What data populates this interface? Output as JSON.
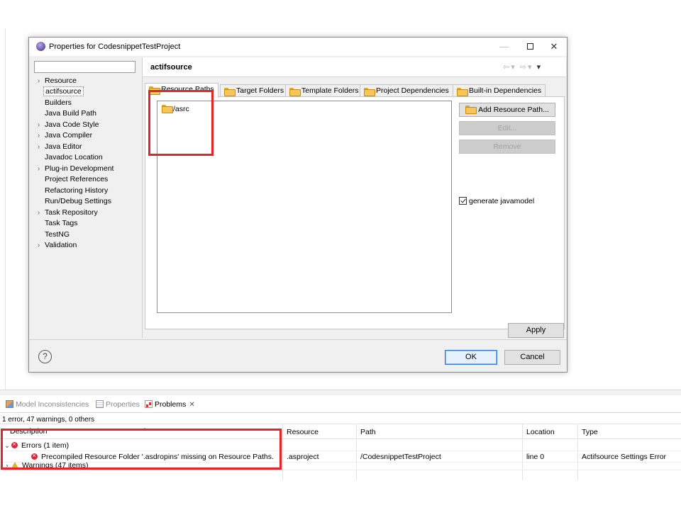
{
  "dialog": {
    "title": "Properties for CodesnippetTestProject",
    "filter": {
      "value": "",
      "placeholder": ""
    },
    "tree": [
      {
        "label": "Resource",
        "expandable": true
      },
      {
        "label": "actifsource",
        "expandable": false,
        "selected": true
      },
      {
        "label": "Builders",
        "expandable": false
      },
      {
        "label": "Java Build Path",
        "expandable": false
      },
      {
        "label": "Java Code Style",
        "expandable": true
      },
      {
        "label": "Java Compiler",
        "expandable": true
      },
      {
        "label": "Java Editor",
        "expandable": true
      },
      {
        "label": "Javadoc Location",
        "expandable": false
      },
      {
        "label": "Plug-in Development",
        "expandable": true
      },
      {
        "label": "Project References",
        "expandable": false
      },
      {
        "label": "Refactoring History",
        "expandable": false
      },
      {
        "label": "Run/Debug Settings",
        "expandable": false
      },
      {
        "label": "Task Repository",
        "expandable": true
      },
      {
        "label": "Task Tags",
        "expandable": false
      },
      {
        "label": "TestNG",
        "expandable": false
      },
      {
        "label": "Validation",
        "expandable": true
      }
    ],
    "page_title": "actifsource",
    "tabs": [
      {
        "label": "Resource Paths",
        "active": true
      },
      {
        "label": "Target Folders",
        "active": false
      },
      {
        "label": "Template Folders",
        "active": false
      },
      {
        "label": "Project Dependencies",
        "active": false
      },
      {
        "label": "Built-in Dependencies",
        "active": false
      }
    ],
    "resource_paths": [
      "/asrc"
    ],
    "buttons": {
      "add_path": "Add Resource Path...",
      "edit": "Edit...",
      "remove": "Remove",
      "apply": "Apply",
      "ok": "OK",
      "cancel": "Cancel"
    },
    "generate_checkbox": {
      "label": "generate javamodel",
      "checked": true
    },
    "help_glyph": "?"
  },
  "problems_view": {
    "tabs": [
      {
        "label": "Model Inconsistencies",
        "active": false
      },
      {
        "label": "Properties",
        "active": false
      },
      {
        "label": "Problems",
        "active": true
      }
    ],
    "summary": "1 error, 47 warnings, 0 others",
    "columns": [
      "Description",
      "Resource",
      "Path",
      "Location",
      "Type"
    ],
    "rows": [
      {
        "kind": "group",
        "severity": "error",
        "description": "Errors (1 item)",
        "resource": "",
        "path": "",
        "location": "",
        "type": ""
      },
      {
        "kind": "item",
        "severity": "error",
        "description": "Precompiled Resource Folder '.asdropins' missing on Resource Paths.",
        "resource": ".asproject",
        "path": "/CodesnippetTestProject",
        "location": "line 0",
        "type": "Actifsource Settings Error"
      },
      {
        "kind": "group",
        "severity": "warning",
        "description": "Warnings (47 items)",
        "resource": "",
        "path": "",
        "location": "",
        "type": ""
      }
    ]
  },
  "colors": {
    "annotation_red": "#e3242b",
    "ok_border": "#2f78d4",
    "error_red": "#d7263d",
    "warning_yellow": "#e8b019",
    "folder_yellow": "#f6c65a"
  }
}
